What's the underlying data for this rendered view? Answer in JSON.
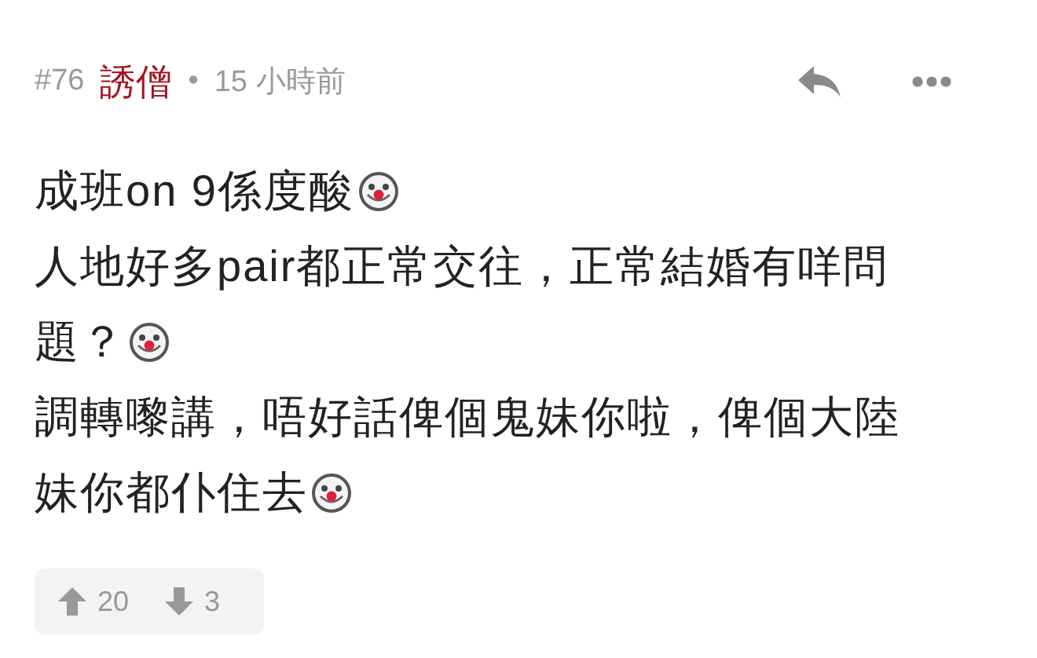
{
  "post": {
    "number": "#76",
    "author": "誘僧",
    "separator": "•",
    "time": "15 小時前"
  },
  "body": [
    {
      "text": "成班on 9係度酸",
      "emoji": true
    },
    {
      "text": "人地好多pair都正常交往，正常結婚有咩問",
      "emoji": false
    },
    {
      "text": "題？",
      "emoji": true
    },
    {
      "text": "調轉嚟講，唔好話俾個鬼妹你啦，俾個大陸",
      "emoji": false
    },
    {
      "text": "妹你都仆住去",
      "emoji": true
    }
  ],
  "votes": {
    "up": "20",
    "down": "3"
  }
}
